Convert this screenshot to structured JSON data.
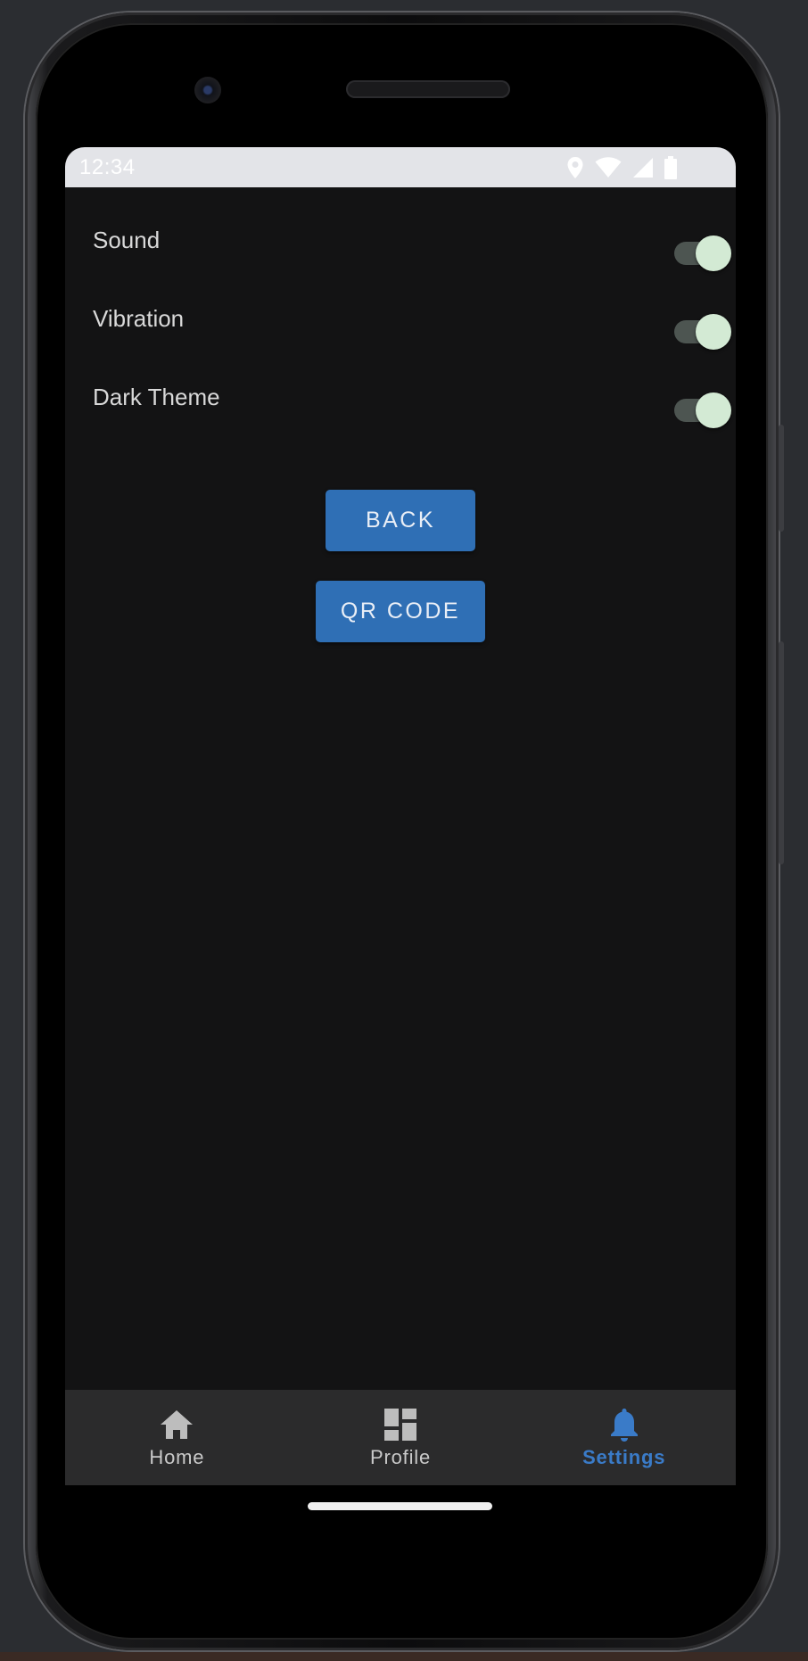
{
  "status_bar": {
    "time": "12:34"
  },
  "settings": [
    {
      "label": "Sound",
      "enabled": true
    },
    {
      "label": "Vibration",
      "enabled": true
    },
    {
      "label": "Dark Theme",
      "enabled": true
    }
  ],
  "buttons": {
    "back": "BACK",
    "qr_code": "QR CODE"
  },
  "bottom_nav": [
    {
      "label": "Home",
      "icon": "home-icon",
      "active": false
    },
    {
      "label": "Profile",
      "icon": "dashboard-icon",
      "active": false
    },
    {
      "label": "Settings",
      "icon": "bell-icon",
      "active": true
    }
  ],
  "colors": {
    "accent": "#3a7bc8",
    "button": "#2f6fb5",
    "screen_bg": "#131314",
    "nav_bg": "#2b2b2c",
    "toggle_thumb": "#d3ead4"
  }
}
